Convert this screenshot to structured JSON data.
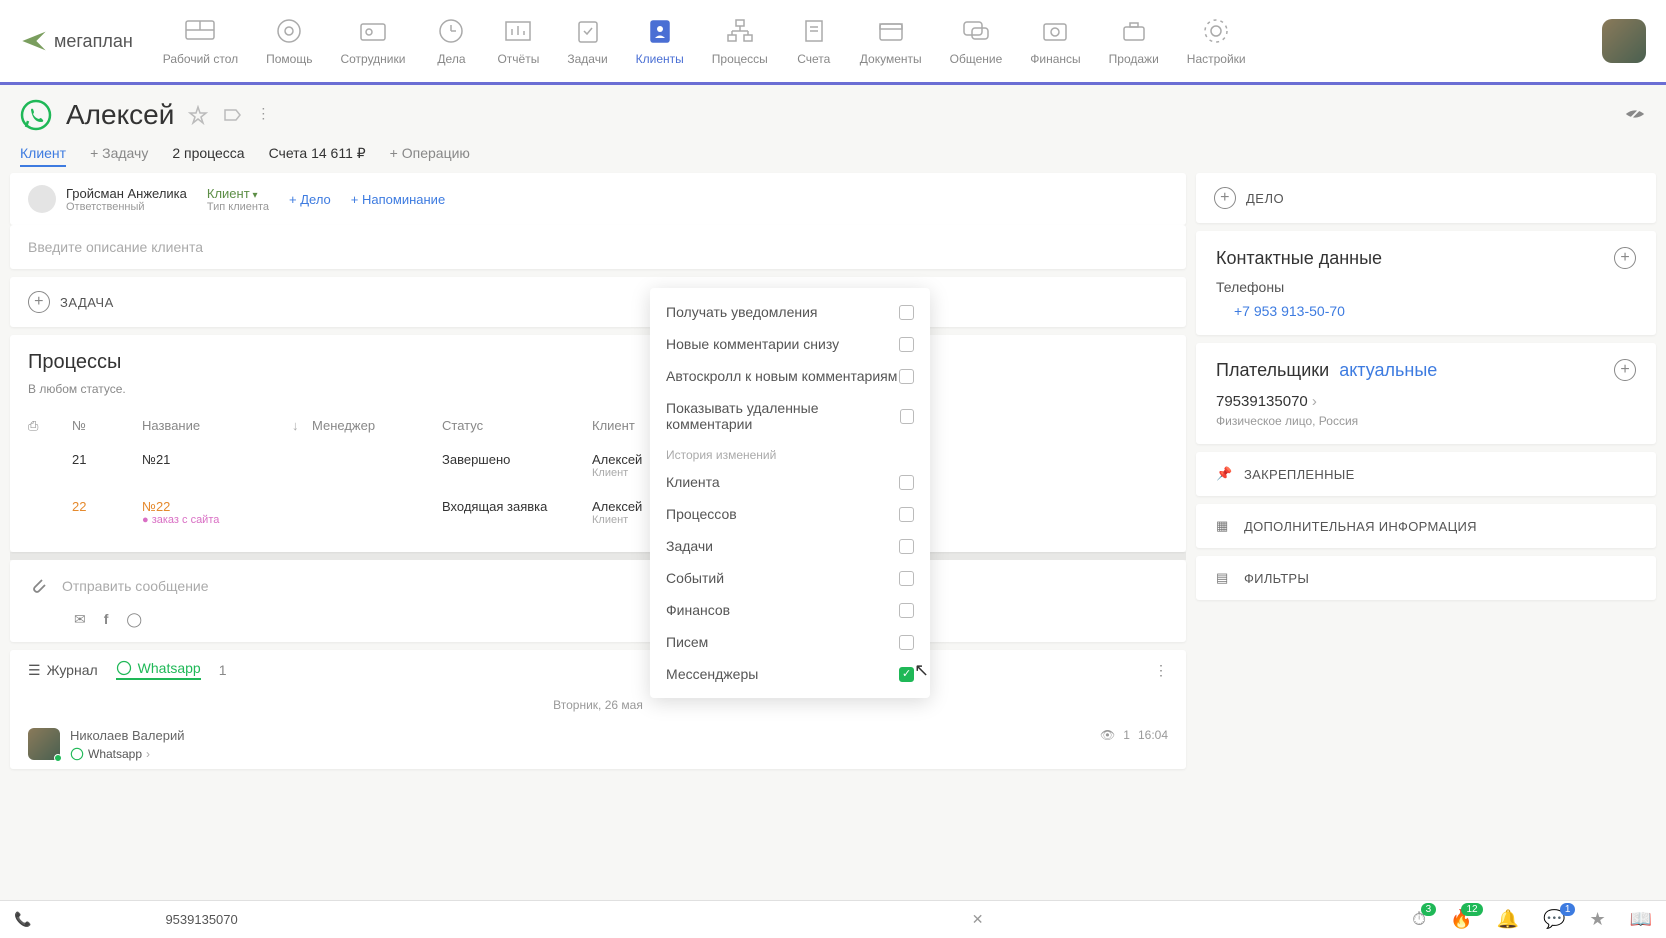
{
  "logo": "мегаплан",
  "nav": [
    {
      "label": "Рабочий стол"
    },
    {
      "label": "Помощь"
    },
    {
      "label": "Сотрудники"
    },
    {
      "label": "Дела"
    },
    {
      "label": "Отчёты"
    },
    {
      "label": "Задачи"
    },
    {
      "label": "Клиенты"
    },
    {
      "label": "Процессы"
    },
    {
      "label": "Счета"
    },
    {
      "label": "Документы"
    },
    {
      "label": "Общение"
    },
    {
      "label": "Финансы"
    },
    {
      "label": "Продажи"
    },
    {
      "label": "Настройки"
    }
  ],
  "client": {
    "name": "Алексей"
  },
  "tabs": {
    "client": "Клиент",
    "task": "+ Задачу",
    "processes": "2 процесса",
    "bills": "Счета 14 611 ₽",
    "operation": "+ Операцию"
  },
  "responsible": {
    "name": "Гройсман Анжелика",
    "role": "Ответственный",
    "type_value": "Клиент",
    "type_label": "Тип клиента",
    "add_deal": "+ Дело",
    "add_reminder": "+ Напоминание"
  },
  "desc_placeholder": "Введите описание клиента",
  "task_label": "ЗАДАЧА",
  "processes": {
    "title": "Процессы",
    "status_any": "В любом статусе.",
    "cols": {
      "num": "№",
      "name": "Название",
      "manager": "Менеджер",
      "status": "Статус",
      "client": "Клиент"
    },
    "rows": [
      {
        "num": "21",
        "name": "№21",
        "sub": "",
        "status": "Завершено",
        "client": "Алексей",
        "client_sub": "Клиент"
      },
      {
        "num": "22",
        "name": "№22",
        "sub": "● заказ с сайта",
        "status": "Входящая заявка",
        "client": "Алексей",
        "client_sub": "Клиент"
      }
    ]
  },
  "message_placeholder": "Отправить сообщение",
  "journal": {
    "label": "Журнал",
    "whatsapp": "Whatsapp",
    "wa_count": "1"
  },
  "date_divider": "Вторник, 26 мая",
  "msg": {
    "author": "Николаев Валерий",
    "via": "Whatsapp",
    "views": "1",
    "time": "16:04"
  },
  "right": {
    "deal": "ДЕЛО",
    "contacts_title": "Контактные данные",
    "phones_label": "Телефоны",
    "phone": "+7 953 913-50-70",
    "payers_title": "Плательщики",
    "payers_actual": "актуальные",
    "payer_num": "79539135070",
    "payer_sub": "Физическое лицо, Россия",
    "pinned": "ЗАКРЕПЛЕННЫЕ",
    "extra": "ДОПОЛНИТЕЛЬНАЯ ИНФОРМАЦИЯ",
    "filters": "ФИЛЬТРЫ"
  },
  "popup": {
    "items1": [
      "Получать уведомления",
      "Новые комментарии снизу",
      "Автоскролл к новым комментариям",
      "Показывать удаленные комментарии"
    ],
    "divider": "История изменений",
    "items2": [
      {
        "label": "Клиента",
        "checked": false
      },
      {
        "label": "Процессов",
        "checked": false
      },
      {
        "label": "Задачи",
        "checked": false
      },
      {
        "label": "Событий",
        "checked": false
      },
      {
        "label": "Финансов",
        "checked": false
      },
      {
        "label": "Писем",
        "checked": false
      },
      {
        "label": "Мессенджеры",
        "checked": true
      }
    ]
  },
  "bottom": {
    "phone": "9539135070",
    "badges": {
      "clock": "3",
      "fire": "12",
      "chat": "1"
    }
  }
}
